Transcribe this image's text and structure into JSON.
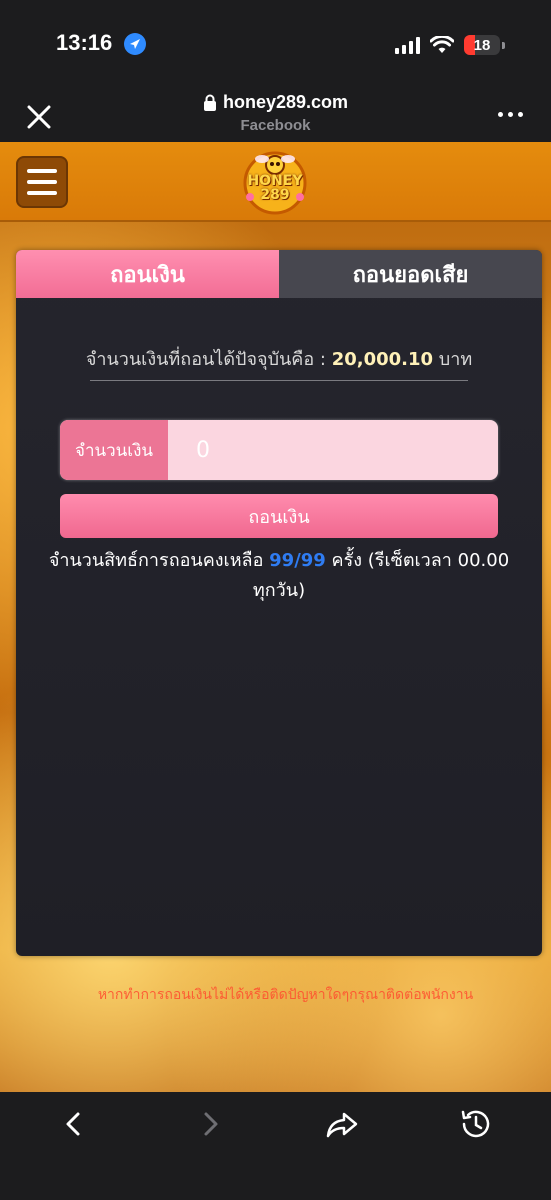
{
  "status_bar": {
    "time": "13:16",
    "battery": "18"
  },
  "browser": {
    "url": "honey289.com",
    "subtitle": "Facebook"
  },
  "site": {
    "logo_text": "HONEY 289"
  },
  "tabs": [
    {
      "label": "ถอนเงิน",
      "active": true
    },
    {
      "label": "ถอนยอดเสีย",
      "active": false
    }
  ],
  "balance": {
    "label": "จำนวนเงินที่ถอนได้ปัจจุบันคือ :",
    "amount": "20,000.10",
    "unit": "บาท"
  },
  "withdraw_form": {
    "amount_label": "จำนวนเงิน",
    "amount_placeholder": "0",
    "submit_label": "ถอนเงิน"
  },
  "rights": {
    "prefix": "จำนวนสิทธ์การถอนคงเหลือ",
    "count": "99/99",
    "suffix": "ครั้ง (รีเซ็ตเวลา 00.00 ทุกวัน)"
  },
  "help_text": "หากทำการถอนเงินไม่ได้หรือติดปัญหาใดๆกรุณาติดต่อพนักงาน",
  "colors": {
    "accent_pink": "#f26d95",
    "count_blue": "#2f7cf2",
    "card_bg": "#25252d",
    "header_orange": "#e58c0e"
  }
}
